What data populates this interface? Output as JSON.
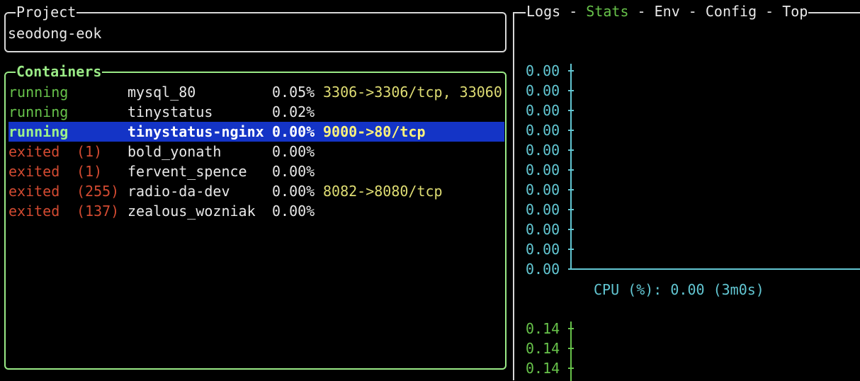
{
  "project": {
    "title": "Project",
    "name": "seodong-eok"
  },
  "containers": {
    "title": "Containers",
    "rows": [
      {
        "state": "running",
        "code": "",
        "name": "mysql_80",
        "cpu": "0.05%",
        "ports": "3306->3306/tcp, 33060",
        "selected": false
      },
      {
        "state": "running",
        "code": "",
        "name": "tinystatus",
        "cpu": "0.02%",
        "ports": "",
        "selected": false
      },
      {
        "state": "running",
        "code": "",
        "name": "tinystatus-nginx",
        "cpu": "0.00%",
        "ports": "9000->80/tcp",
        "selected": true
      },
      {
        "state": "exited",
        "code": "(1)",
        "name": "bold_yonath",
        "cpu": "0.00%",
        "ports": "",
        "selected": false
      },
      {
        "state": "exited",
        "code": "(1)",
        "name": "fervent_spence",
        "cpu": "0.00%",
        "ports": "",
        "selected": false
      },
      {
        "state": "exited",
        "code": "(255)",
        "name": "radio-da-dev",
        "cpu": "0.00%",
        "ports": "8082->8080/tcp",
        "selected": false
      },
      {
        "state": "exited",
        "code": "(137)",
        "name": "zealous_wozniak",
        "cpu": "0.00%",
        "ports": "",
        "selected": false
      }
    ]
  },
  "tabs": {
    "items": [
      "Logs",
      "Stats",
      "Env",
      "Config",
      "Top"
    ],
    "active": "Stats",
    "separator": " - "
  },
  "stats": {
    "cpu_chart": {
      "y_labels": [
        "0.00",
        "0.00",
        "0.00",
        "0.00",
        "0.00",
        "0.00",
        "0.00",
        "0.00",
        "0.00",
        "0.00",
        "0.00"
      ],
      "caption": "CPU (%): 0.00 (3m0s)"
    },
    "memory_chart": {
      "y_labels": [
        "0.14",
        "0.14",
        "0.14"
      ]
    }
  },
  "colors": {
    "running": "#67c24a",
    "exited": "#d24a31",
    "ports": "#dedc73",
    "selected_bg": "#1434c6",
    "cpu_axis": "#62c6d2",
    "mem_axis": "#67c24a",
    "active_pane_border": "#9aea86"
  },
  "chart_data": [
    {
      "type": "line",
      "ylabel": "",
      "y_tick_labels": [
        "0.00",
        "0.00",
        "0.00",
        "0.00",
        "0.00",
        "0.00",
        "0.00",
        "0.00",
        "0.00",
        "0.00",
        "0.00"
      ],
      "caption": "CPU (%): 0.00 (3m0s)",
      "series": [
        {
          "values": []
        }
      ]
    },
    {
      "type": "line",
      "y_tick_labels": [
        "0.14",
        "0.14",
        "0.14"
      ],
      "series": [
        {
          "values": []
        }
      ]
    }
  ]
}
